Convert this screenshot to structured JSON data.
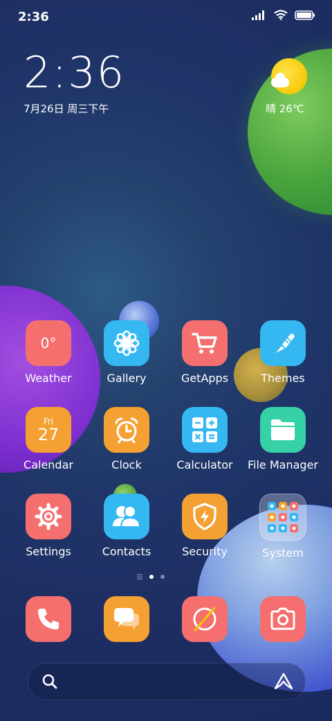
{
  "status_bar": {
    "time": "2:36",
    "icons": [
      "signal-icon",
      "wifi-icon",
      "battery-icon"
    ]
  },
  "clock_widget": {
    "time": "2:36",
    "date": "7月26日 周三下午"
  },
  "weather_widget": {
    "text": "晴 26℃",
    "icon": "sun-cloud-icon"
  },
  "apps": {
    "weather": {
      "label": "Weather",
      "value": "0°"
    },
    "gallery": {
      "label": "Gallery"
    },
    "getapps": {
      "label": "GetApps"
    },
    "themes": {
      "label": "Themes"
    },
    "calendar": {
      "label": "Calendar",
      "day": "Fri",
      "date": "27"
    },
    "clock": {
      "label": "Clock"
    },
    "calculator": {
      "label": "Calculator"
    },
    "file_manager": {
      "label": "File Manager"
    },
    "settings": {
      "label": "Settings"
    },
    "contacts": {
      "label": "Contacts"
    },
    "security": {
      "label": "Security"
    },
    "system": {
      "label": "System"
    }
  },
  "page_indicator": {
    "pages": 2,
    "current": 1
  },
  "dock": [
    "phone",
    "messages",
    "browser",
    "camera"
  ],
  "colors": {
    "background": "#1d2d62",
    "red": "#f56f6f",
    "cyan": "#35b8f1",
    "orange": "#f5a033",
    "teal": "#37d1a8",
    "sun": "#f7c600"
  }
}
